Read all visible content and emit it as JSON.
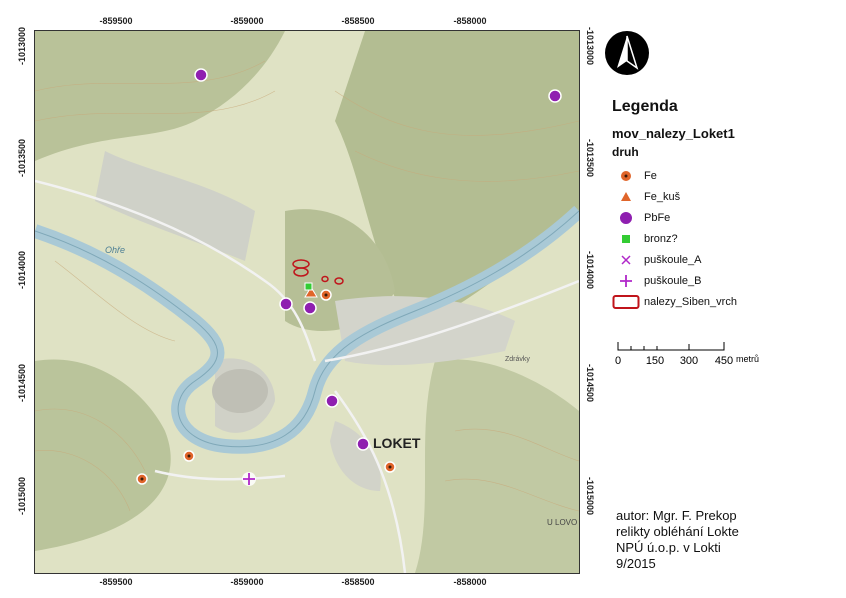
{
  "map": {
    "x_ticks": [
      "-859500",
      "-859000",
      "-858500",
      "-858000"
    ],
    "y_ticks": [
      "-1013000",
      "-1013500",
      "-1014000",
      "-1014500",
      "-1015000"
    ],
    "place_labels": {
      "town": "LOKET",
      "river": "Ohře",
      "settlement_east": "U LOVO",
      "settlement_mid": "Zdrávky"
    },
    "colors": {
      "river": "#a9c9d6",
      "terrain": "#dfe2c4",
      "forest": "#b9c299",
      "fe": "#e0652a",
      "pbfe": "#8f1fb0",
      "bronz": "#33cc33",
      "puskoule": "#b027c9",
      "polygon": "#c0141b"
    }
  },
  "legend": {
    "title": "Legenda",
    "layer": "mov_nalezy_Loket1",
    "field": "druh",
    "items": [
      {
        "label": "Fe",
        "icon": "fe-dot-icon"
      },
      {
        "label": "Fe_kuš",
        "icon": "fe-kus-triangle-icon"
      },
      {
        "label": "PbFe",
        "icon": "pbfe-circle-icon"
      },
      {
        "label": "bronz?",
        "icon": "bronz-square-icon"
      },
      {
        "label": "puškoule_A",
        "icon": "puskoule-a-cross-icon"
      },
      {
        "label": "puškoule_B",
        "icon": "puskoule-b-plus-icon"
      },
      {
        "label": "nalezy_Siben_vrch",
        "icon": "polygon-outline-icon"
      }
    ]
  },
  "scale": {
    "labels": [
      "0",
      "150",
      "300",
      "450"
    ],
    "unit": "metrů"
  },
  "author": {
    "lines": [
      "autor: Mgr. F. Prekop",
      "relikty obléhání Lokte",
      "NPÚ ú.o.p. v Lokti",
      "9/2015"
    ]
  }
}
